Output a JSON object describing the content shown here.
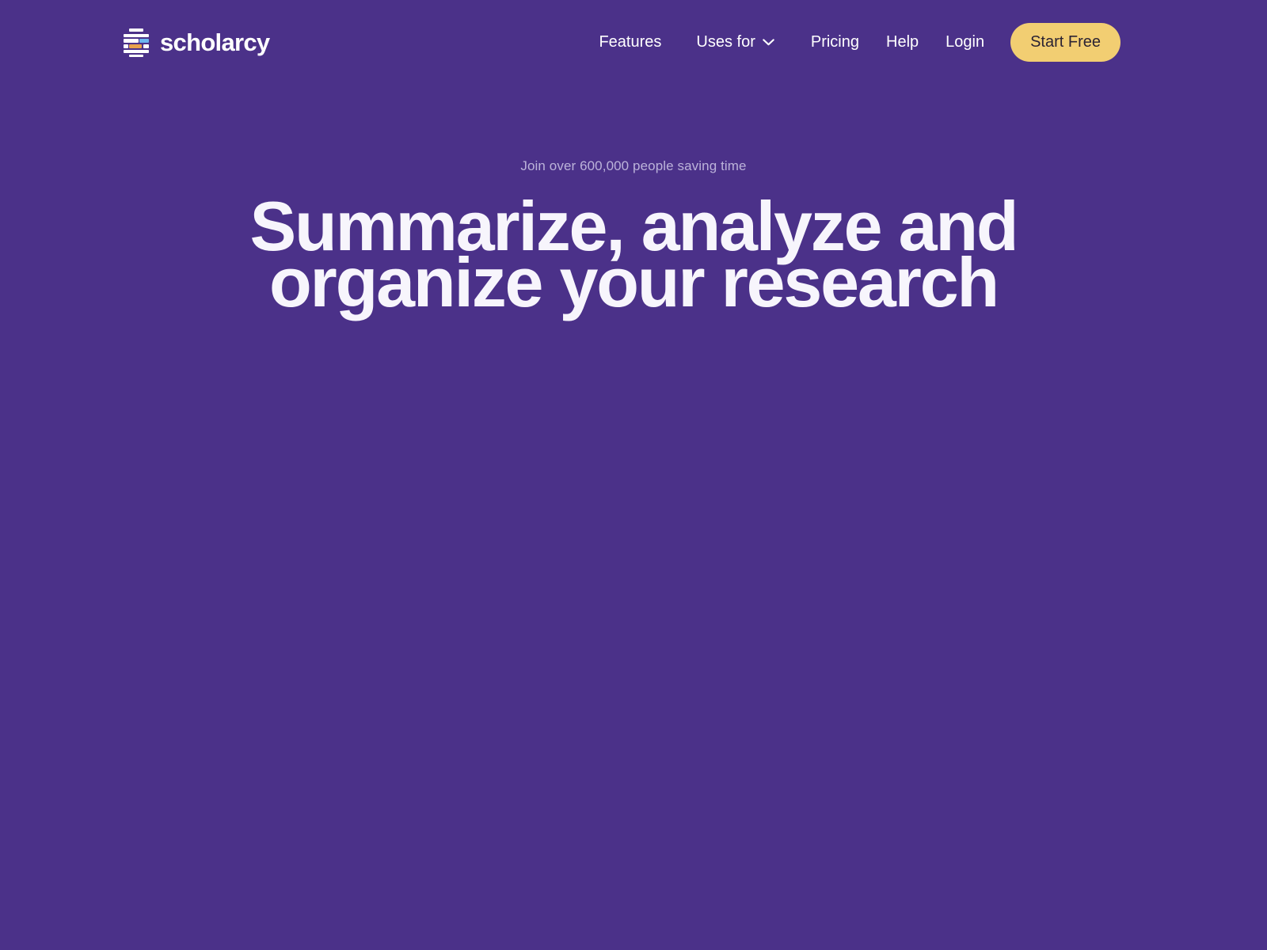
{
  "brand": {
    "name": "scholarcy",
    "logo_icon": "scholarcy-document-lines-logo",
    "colors": {
      "background": "#4B3189",
      "accent_blue": "#6CB6F0",
      "accent_orange": "#E8A24C",
      "cta_yellow": "#F2CE72",
      "cta_text": "#2B2333",
      "eyebrow_text": "#BCB3DA",
      "heading_text": "#F7F5FC"
    }
  },
  "nav": {
    "items": [
      {
        "label": "Features",
        "icon": null
      },
      {
        "label": "Uses for",
        "icon": "chevron-down-icon"
      },
      {
        "label": "Pricing",
        "icon": null
      },
      {
        "label": "Help",
        "icon": null
      },
      {
        "label": "Login",
        "icon": null
      }
    ],
    "cta_label": "Start Free"
  },
  "hero": {
    "eyebrow": "Join over 600,000 people saving time",
    "title_line_1": "Summarize, analyze and",
    "title_line_2": "organize your research"
  }
}
